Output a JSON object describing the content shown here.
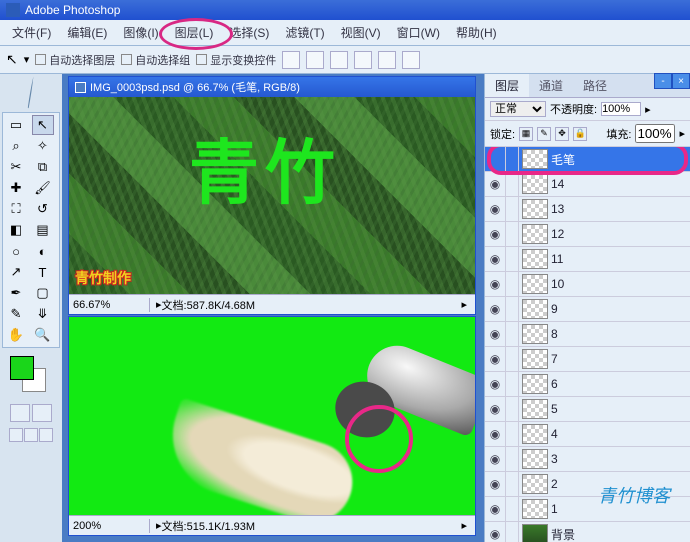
{
  "title": "Adobe Photoshop",
  "menu": {
    "file": "文件(F)",
    "edit": "编辑(E)",
    "image": "图像(I)",
    "layer": "图层(L)",
    "select": "选择(S)",
    "filter": "滤镜(T)",
    "view": "视图(V)",
    "window": "窗口(W)",
    "help": "帮助(H)"
  },
  "opt": {
    "autoSelLayer": "自动选择图层",
    "autoSelGroup": "自动选择组",
    "showTransform": "显示变换控件"
  },
  "doc1": {
    "title": "IMG_0003psd.psd @ 66.7% (毛笔, RGB/8)",
    "zoom": "66.67%",
    "status": "文档:587.8K/4.68M",
    "text": "青竹",
    "stamp": "青竹制作"
  },
  "doc2": {
    "zoom": "200%",
    "status": "文档:515.1K/1.93M"
  },
  "panel": {
    "tabs": {
      "layers": "图层",
      "channels": "通道",
      "paths": "路径"
    },
    "opacityLabel": "不透明度:",
    "opacity": "100%",
    "blend": "正常",
    "lockLabel": "锁定:",
    "fillLabel": "填充:",
    "fill": "100%"
  },
  "layers": [
    {
      "name": "毛笔",
      "sel": true,
      "eye": false
    },
    {
      "name": "14"
    },
    {
      "name": "13"
    },
    {
      "name": "12"
    },
    {
      "name": "11"
    },
    {
      "name": "10"
    },
    {
      "name": "9"
    },
    {
      "name": "8"
    },
    {
      "name": "7"
    },
    {
      "name": "6"
    },
    {
      "name": "5"
    },
    {
      "name": "4"
    },
    {
      "name": "3"
    },
    {
      "name": "2"
    },
    {
      "name": "1"
    },
    {
      "name": "背景",
      "bg": true
    }
  ],
  "watermark": "青竹博客"
}
